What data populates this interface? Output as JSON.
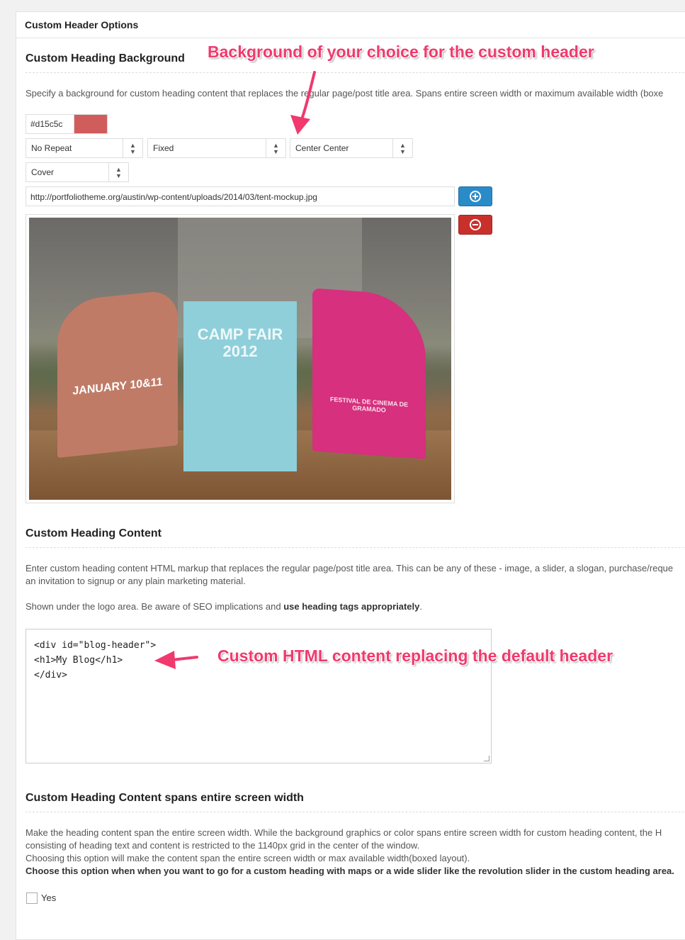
{
  "panel": {
    "title": "Custom Header Options"
  },
  "background": {
    "title": "Custom Heading Background",
    "description": "Specify a background for custom heading content that replaces the regular page/post title area. Spans entire screen width or maximum available width (boxe",
    "color_value": "#d15c5c",
    "swatch_color": "#d15c5c",
    "repeat": "No Repeat",
    "attachment": "Fixed",
    "position": "Center Center",
    "size": "Cover",
    "image_url": "http://portfoliotheme.org/austin/wp-content/uploads/2014/03/tent-mockup.jpg",
    "preview_cards": {
      "left": "JANUARY 10&11",
      "middle": "CAMP FAIR 2012",
      "right": "FESTIVAL DE CINEMA DE GRAMADO"
    }
  },
  "content": {
    "title": "Custom Heading Content",
    "description_line1": "Enter custom heading content HTML markup that replaces the regular page/post title area. This can be any of these - image, a slider, a slogan, purchase/reque",
    "description_line2": "an invitation to signup or any plain marketing material.",
    "note_prefix": "Shown under the logo area. Be aware of SEO implications and ",
    "note_bold": "use heading tags appropriately",
    "note_suffix": ".",
    "code": "<div id=\"blog-header\">\n<h1>My Blog</h1>\n</div>"
  },
  "span": {
    "title": "Custom Heading Content spans entire screen width",
    "line1": "Make the heading content span the entire screen width. While the background graphics or color spans entire screen width for custom heading content, the H",
    "line2": "consisting of heading text and content is restricted to the 1140px grid in the center of the window.",
    "line3": "Choosing this option will make the content span the entire screen width or max available width(boxed layout).",
    "line4": "Choose this option when when you want to go for a custom heading with maps or a wide slider like the revolution slider in the custom heading area.",
    "checkbox_label": "Yes"
  },
  "annotations": {
    "background": "Background of your choice for the custom header",
    "content": "Custom HTML content replacing the default header",
    "color": "#f0396d"
  }
}
